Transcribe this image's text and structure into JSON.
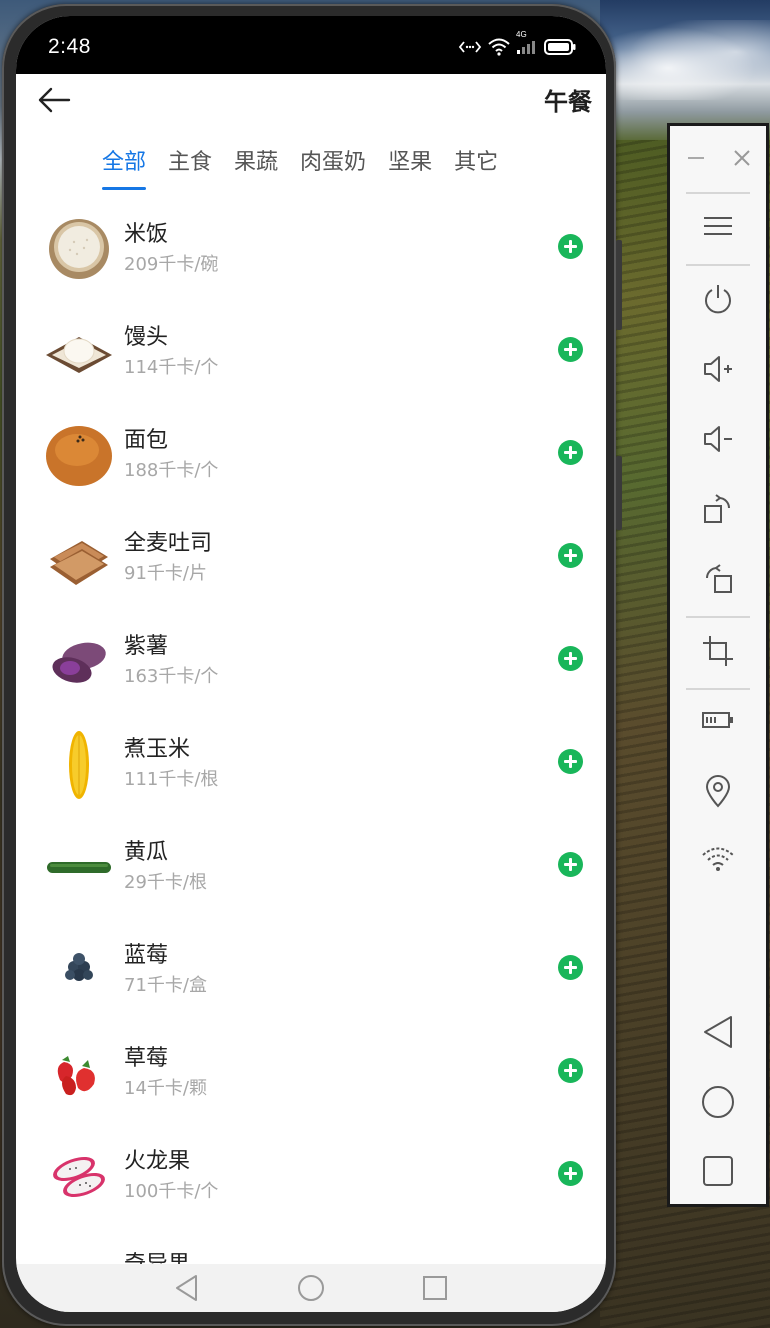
{
  "status_bar": {
    "time": "2:48",
    "network": "4G"
  },
  "header": {
    "meal": "午餐"
  },
  "tabs": [
    {
      "label": "全部",
      "active": true
    },
    {
      "label": "主食",
      "active": false
    },
    {
      "label": "果蔬",
      "active": false
    },
    {
      "label": "肉蛋奶",
      "active": false
    },
    {
      "label": "坚果",
      "active": false
    },
    {
      "label": "其它",
      "active": false
    }
  ],
  "foods": [
    {
      "name": "米饭",
      "calories": "209千卡/碗",
      "icon": "rice-bowl-icon"
    },
    {
      "name": "馒头",
      "calories": "114千卡/个",
      "icon": "steamed-bun-icon"
    },
    {
      "name": "面包",
      "calories": "188千卡/个",
      "icon": "bread-icon"
    },
    {
      "name": "全麦吐司",
      "calories": "91千卡/片",
      "icon": "toast-icon"
    },
    {
      "name": "紫薯",
      "calories": "163千卡/个",
      "icon": "purple-sweet-potato-icon"
    },
    {
      "name": "煮玉米",
      "calories": "111千卡/根",
      "icon": "corn-icon"
    },
    {
      "name": "黄瓜",
      "calories": "29千卡/根",
      "icon": "cucumber-icon"
    },
    {
      "name": "蓝莓",
      "calories": "71千卡/盒",
      "icon": "blueberry-icon"
    },
    {
      "name": "草莓",
      "calories": "14千卡/颗",
      "icon": "strawberry-icon"
    },
    {
      "name": "火龙果",
      "calories": "100千卡/个",
      "icon": "dragon-fruit-icon"
    },
    {
      "name": "奇异果",
      "calories": "",
      "icon": "kiwi-icon"
    }
  ],
  "colors": {
    "accent": "#1677e5",
    "add_button": "#19b65a",
    "calorie_text": "#a7a7a7"
  }
}
